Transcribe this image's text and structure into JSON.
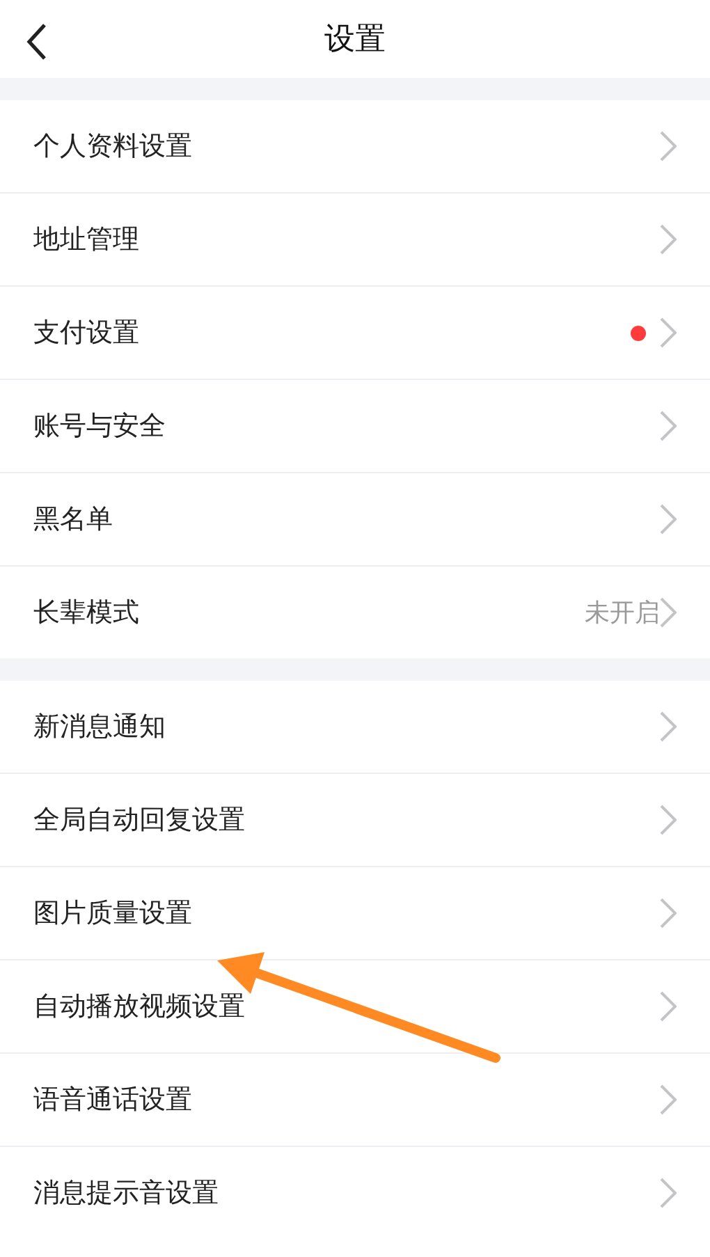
{
  "header": {
    "title": "设置"
  },
  "groups": [
    {
      "items": [
        {
          "label": "个人资料设置",
          "dot": false
        },
        {
          "label": "地址管理",
          "dot": false
        },
        {
          "label": "支付设置",
          "dot": true
        },
        {
          "label": "账号与安全",
          "dot": false
        },
        {
          "label": "黑名单",
          "dot": false
        },
        {
          "label": "长辈模式",
          "dot": false,
          "value": "未开启"
        }
      ]
    },
    {
      "items": [
        {
          "label": "新消息通知",
          "dot": false
        },
        {
          "label": "全局自动回复设置",
          "dot": false
        },
        {
          "label": "图片质量设置",
          "dot": false
        },
        {
          "label": "自动播放视频设置",
          "dot": false
        },
        {
          "label": "语音通话设置",
          "dot": false
        },
        {
          "label": "消息提示音设置",
          "dot": false
        }
      ]
    }
  ]
}
